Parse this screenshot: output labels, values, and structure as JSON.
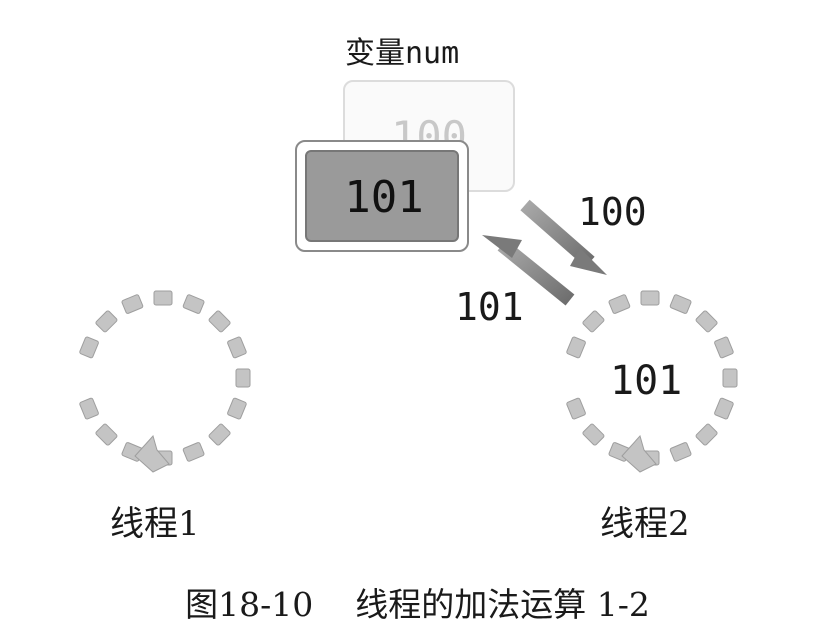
{
  "variable": {
    "label": "变量num",
    "old_value": "100",
    "new_value": "101"
  },
  "arrows": {
    "to_thread_value": "100",
    "from_thread_value": "101"
  },
  "threads": [
    {
      "label": "线程1",
      "value": ""
    },
    {
      "label": "线程2",
      "value": "101"
    }
  ],
  "caption": {
    "figure_no": "图18-10",
    "title": "线程的加法运算 1-2"
  },
  "colors": {
    "arrow": "#8c8c8c",
    "dot": "#c4c4c4",
    "card_fill": "#9a9a9a"
  }
}
